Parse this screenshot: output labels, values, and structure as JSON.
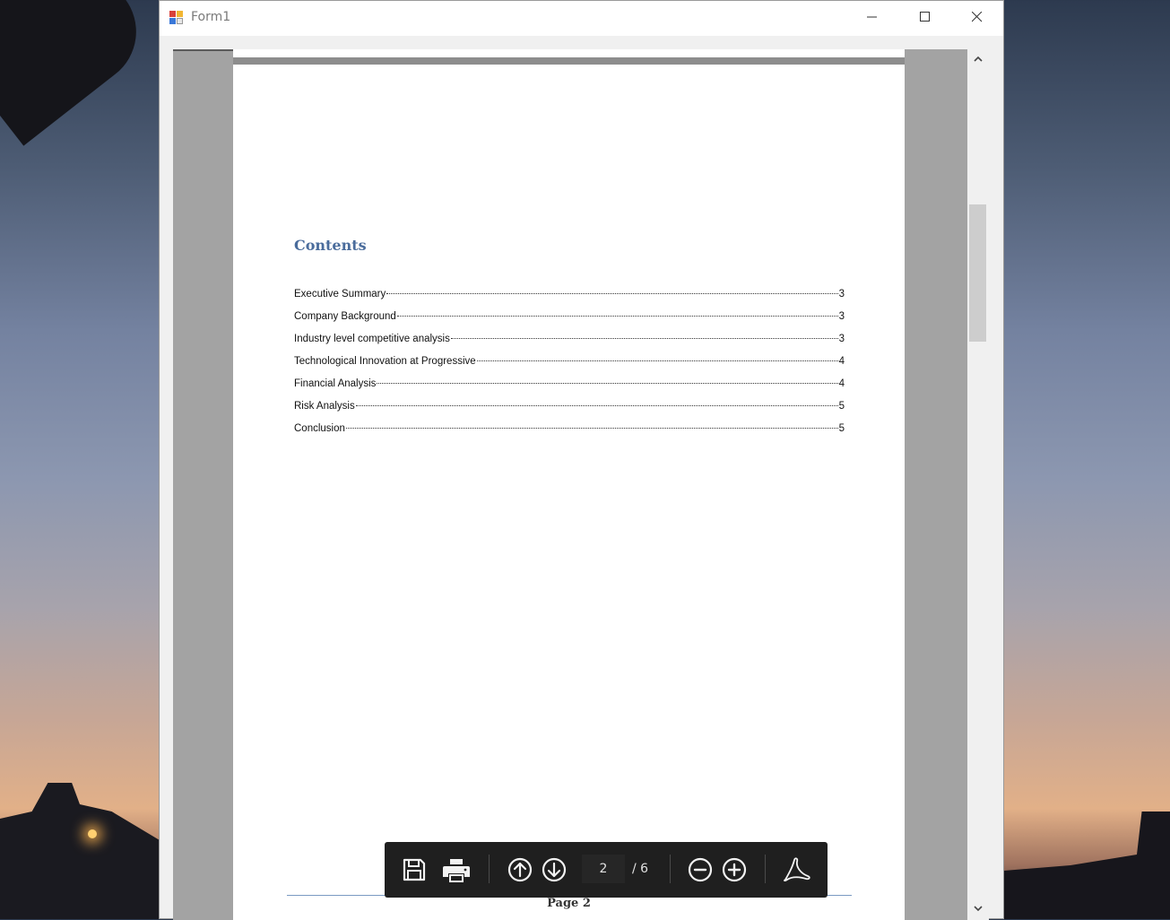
{
  "window": {
    "title": "Form1"
  },
  "document": {
    "heading": "Contents",
    "toc": [
      {
        "title": "Executive Summary ",
        "page": "3"
      },
      {
        "title": "Company Background",
        "page": "3"
      },
      {
        "title": "Industry level competitive analysis ",
        "page": "3"
      },
      {
        "title": "Technological Innovation at Progressive",
        "page": "4"
      },
      {
        "title": "Financial Analysis",
        "page": "4"
      },
      {
        "title": "Risk Analysis",
        "page": "5"
      },
      {
        "title": "Conclusion ",
        "page": "5"
      }
    ],
    "footer": "Page 2"
  },
  "toolbar": {
    "current_page": "2",
    "total_pages": "/ 6",
    "icons": [
      "save-icon",
      "print-icon",
      "page-up-icon",
      "page-down-icon",
      "zoom-out-icon",
      "zoom-in-icon",
      "acrobat-icon"
    ]
  },
  "colors": {
    "heading": "#4a6c9c",
    "toolbar_bg": "#1f1f1f",
    "viewer_bg": "#a3a3a3"
  }
}
